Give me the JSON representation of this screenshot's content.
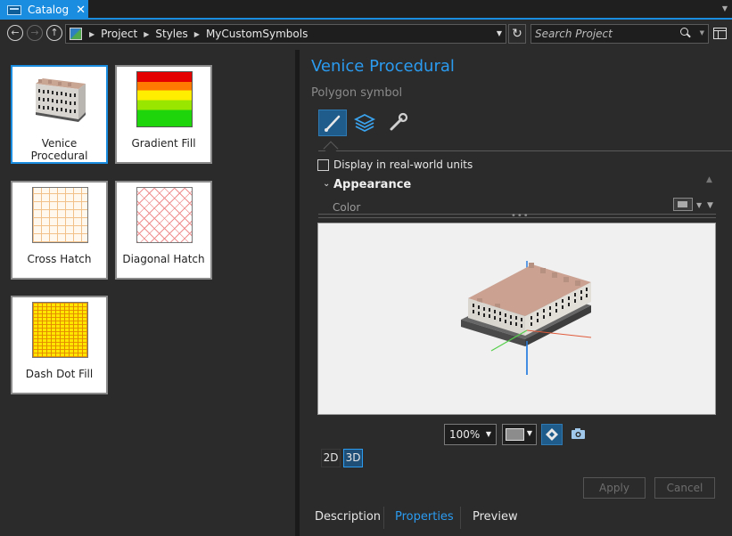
{
  "tab": {
    "title": "Catalog",
    "close_glyph": "✕",
    "icon": "catalog-icon"
  },
  "addressbar": {
    "breadcrumbs": [
      "Project",
      "Styles",
      "MyCustomSymbols"
    ],
    "search_placeholder": "Search Project"
  },
  "gallery": {
    "items": [
      {
        "label": "Venice Procedural",
        "selected": true
      },
      {
        "label": "Gradient Fill"
      },
      {
        "label": "Cross Hatch"
      },
      {
        "label": "Diagonal Hatch"
      },
      {
        "label": "Dash Dot Fill"
      }
    ]
  },
  "symbol": {
    "title": "Venice Procedural",
    "subtitle": "Polygon symbol",
    "realworld_label": "Display in real-world units",
    "appearance_label": "Appearance",
    "color_label": "Color"
  },
  "preview": {
    "zoom": "100%",
    "dim_2d": "2D",
    "dim_3d": "3D",
    "active_dim": "3D"
  },
  "actions": {
    "apply": "Apply",
    "cancel": "Cancel"
  },
  "bottom_tabs": [
    {
      "label": "Description"
    },
    {
      "label": "Properties",
      "active": true
    },
    {
      "label": "Preview"
    }
  ],
  "colors": {
    "accent": "#1b8de0",
    "title_blue": "#2b9bf0",
    "background": "#2b2b2b"
  }
}
